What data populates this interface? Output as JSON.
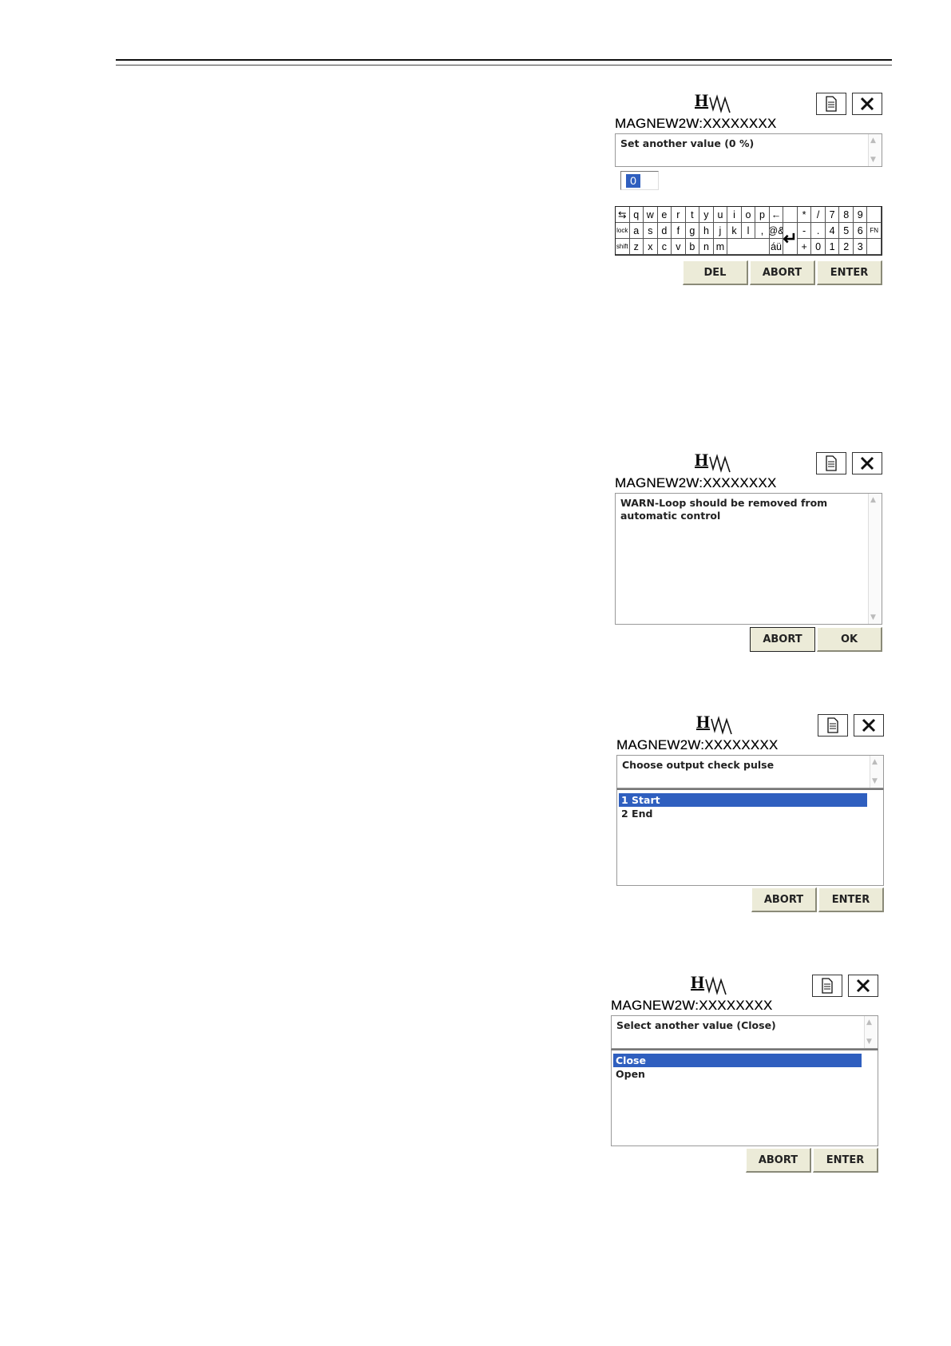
{
  "logo_text": "H",
  "screens": [
    {
      "device_tag": "MAGNEW2W:XXXXXXXX",
      "prompt": "Set another value (0 %)",
      "value": "0",
      "keyboard": {
        "row1": [
          "q",
          "w",
          "e",
          "r",
          "t",
          "y",
          "u",
          "i",
          "o",
          "p",
          "←",
          " ",
          "*",
          "/",
          "7",
          "8",
          "9"
        ],
        "row1_left": "⇆",
        "row2_left": "lock",
        "row2": [
          "a",
          "s",
          "d",
          "f",
          "g",
          "h",
          "j",
          "k",
          "l",
          ",",
          "@&",
          "↵",
          "-",
          ".",
          "4",
          "5",
          "6",
          "FN"
        ],
        "row3_left": "shift",
        "row3": [
          "z",
          "x",
          "c",
          "v",
          "b",
          "n",
          "m",
          "",
          "áü",
          "+",
          "0",
          "1",
          "2",
          "3"
        ]
      },
      "buttons": [
        "DEL",
        "ABORT",
        "ENTER"
      ]
    },
    {
      "device_tag": "MAGNEW2W:XXXXXXXX",
      "message": "WARN-Loop should be removed from automatic control",
      "buttons": [
        "ABORT",
        "OK"
      ]
    },
    {
      "device_tag": "MAGNEW2W:XXXXXXXX",
      "prompt": "Choose output check pulse",
      "options": [
        "1 Start",
        "2 End"
      ],
      "buttons": [
        "ABORT",
        "ENTER"
      ]
    },
    {
      "device_tag": "MAGNEW2W:XXXXXXXX",
      "prompt": "Select another value (Close)",
      "options": [
        "Close",
        "Open"
      ],
      "buttons": [
        "ABORT",
        "ENTER"
      ]
    }
  ]
}
